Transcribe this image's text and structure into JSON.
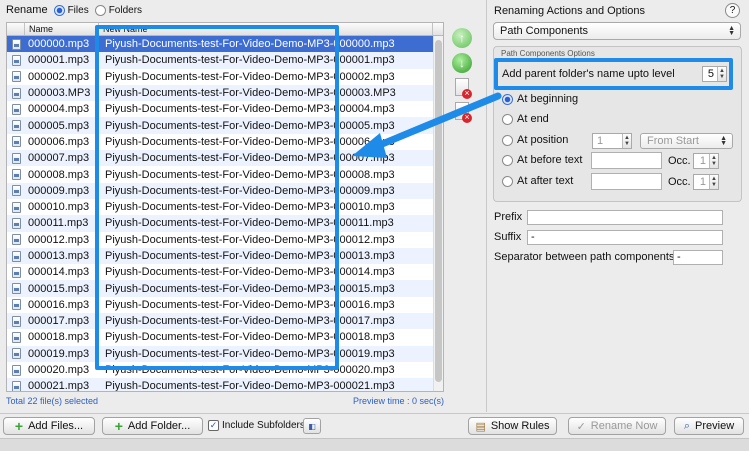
{
  "rename": {
    "label": "Rename",
    "files": "Files",
    "folders": "Folders"
  },
  "table": {
    "headers": [
      "",
      "Name",
      "New Name"
    ],
    "rows": [
      {
        "name": "000000.mp3",
        "new": "Piyush-Documents-test-For-Video-Demo-MP3-000000.mp3"
      },
      {
        "name": "000001.mp3",
        "new": "Piyush-Documents-test-For-Video-Demo-MP3-000001.mp3"
      },
      {
        "name": "000002.mp3",
        "new": "Piyush-Documents-test-For-Video-Demo-MP3-000002.mp3"
      },
      {
        "name": "000003.MP3",
        "new": "Piyush-Documents-test-For-Video-Demo-MP3-000003.MP3"
      },
      {
        "name": "000004.mp3",
        "new": "Piyush-Documents-test-For-Video-Demo-MP3-000004.mp3"
      },
      {
        "name": "000005.mp3",
        "new": "Piyush-Documents-test-For-Video-Demo-MP3-000005.mp3"
      },
      {
        "name": "000006.mp3",
        "new": "Piyush-Documents-test-For-Video-Demo-MP3-000006.mp3"
      },
      {
        "name": "000007.mp3",
        "new": "Piyush-Documents-test-For-Video-Demo-MP3-000007.mp3"
      },
      {
        "name": "000008.mp3",
        "new": "Piyush-Documents-test-For-Video-Demo-MP3-000008.mp3"
      },
      {
        "name": "000009.mp3",
        "new": "Piyush-Documents-test-For-Video-Demo-MP3-000009.mp3"
      },
      {
        "name": "000010.mp3",
        "new": "Piyush-Documents-test-For-Video-Demo-MP3-000010.mp3"
      },
      {
        "name": "000011.mp3",
        "new": "Piyush-Documents-test-For-Video-Demo-MP3-000011.mp3"
      },
      {
        "name": "000012.mp3",
        "new": "Piyush-Documents-test-For-Video-Demo-MP3-000012.mp3"
      },
      {
        "name": "000013.mp3",
        "new": "Piyush-Documents-test-For-Video-Demo-MP3-000013.mp3"
      },
      {
        "name": "000014.mp3",
        "new": "Piyush-Documents-test-For-Video-Demo-MP3-000014.mp3"
      },
      {
        "name": "000015.mp3",
        "new": "Piyush-Documents-test-For-Video-Demo-MP3-000015.mp3"
      },
      {
        "name": "000016.mp3",
        "new": "Piyush-Documents-test-For-Video-Demo-MP3-000016.mp3"
      },
      {
        "name": "000017.mp3",
        "new": "Piyush-Documents-test-For-Video-Demo-MP3-000017.mp3"
      },
      {
        "name": "000018.mp3",
        "new": "Piyush-Documents-test-For-Video-Demo-MP3-000018.mp3"
      },
      {
        "name": "000019.mp3",
        "new": "Piyush-Documents-test-For-Video-Demo-MP3-000019.mp3"
      },
      {
        "name": "000020.mp3",
        "new": "Piyush-Documents-test-For-Video-Demo-MP3-000020.mp3"
      },
      {
        "name": "000021.mp3",
        "new": "Piyush-Documents-test-For-Video-Demo-MP3-000021.mp3"
      }
    ],
    "selected_index": 0
  },
  "status": {
    "total": "Total 22 file(s) selected",
    "preview_time": "Preview time : 0 sec(s)"
  },
  "panel": {
    "title": "Renaming Actions and Options",
    "help": "?",
    "action": "Path Components",
    "group_title": "Path Components Options",
    "level_label": "Add parent folder's name upto level",
    "level_value": "5",
    "at_beginning": "At beginning",
    "at_end": "At end",
    "at_position": "At position",
    "position_value": "1",
    "position_from": "From Start",
    "at_before_text": "At before text",
    "at_after_text": "At after text",
    "occ_label": "Occ.",
    "occ_before": "1",
    "occ_after": "1",
    "prefix_label": "Prefix",
    "prefix_value": "",
    "suffix_label": "Suffix",
    "suffix_value": "-",
    "separator_label": "Separator between path components",
    "separator_value": "-"
  },
  "bottom": {
    "add_files": "Add Files...",
    "add_folder": "Add Folder...",
    "include_subfolders": "Include Subfolders",
    "show_rules": "Show Rules",
    "rename_now": "Rename Now",
    "preview": "Preview"
  },
  "colors": {
    "highlight": "#1f8be8",
    "selection": "#3d6dd1",
    "status_text": "#2c5fc6"
  }
}
